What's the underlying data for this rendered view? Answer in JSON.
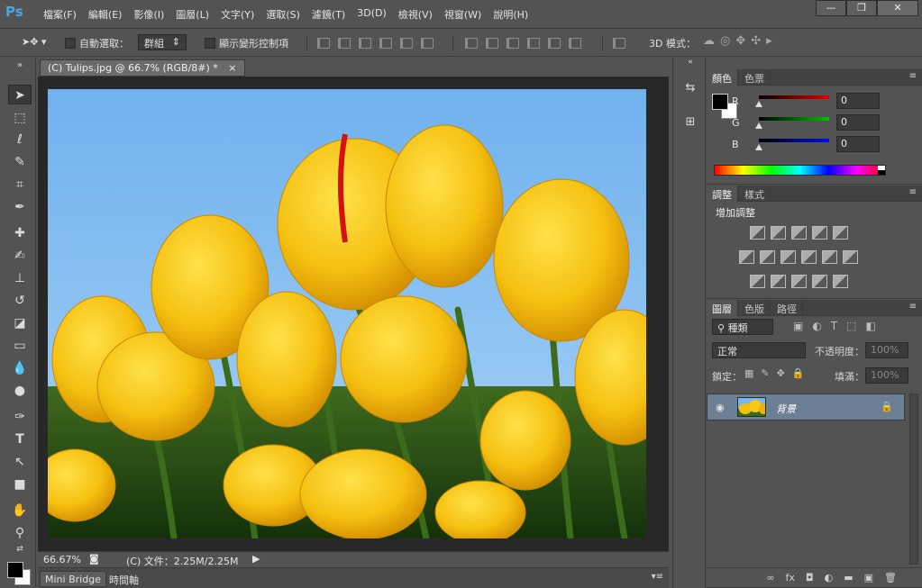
{
  "app": {
    "logo": "Ps",
    "menus": [
      "檔案(F)",
      "編輯(E)",
      "影像(I)",
      "圖層(L)",
      "文字(Y)",
      "選取(S)",
      "濾鏡(T)",
      "3D(D)",
      "檢視(V)",
      "視窗(W)",
      "說明(H)"
    ],
    "window_controls": [
      "—",
      "❐",
      "✕"
    ]
  },
  "options_bar": {
    "auto_select_label": "自動選取：",
    "auto_select_mode": "群組",
    "transform_controls_label": "顯示變形控制項",
    "mode_3d_label": "3D 模式："
  },
  "document": {
    "tab_title": "(C) Tulips.jpg @ 66.7% (RGB/8#) *",
    "tab_close": "×",
    "zoom": "66.67%",
    "file_info": "(C) 文件：2.25M/2.25M"
  },
  "bottom_tabs": [
    "Mini Bridge",
    "時間軸"
  ],
  "color_panel": {
    "tabs": [
      "顏色",
      "色票"
    ],
    "channels": [
      {
        "label": "R",
        "value": "0",
        "color": "#e00000"
      },
      {
        "label": "G",
        "value": "0",
        "color": "#00c000"
      },
      {
        "label": "B",
        "value": "0",
        "color": "#0010e0"
      }
    ]
  },
  "adjustments_panel": {
    "tabs": [
      "調整",
      "樣式"
    ],
    "heading": "增加調整"
  },
  "layers_panel": {
    "tabs": [
      "圖層",
      "色版",
      "路徑"
    ],
    "filter_kind": "種類",
    "blend_mode": "正常",
    "opacity_label": "不透明度：",
    "opacity_value": "100%",
    "lock_label": "鎖定：",
    "fill_label": "填滿：",
    "fill_value": "100%",
    "layer_name": "背景",
    "footer_icons": [
      "∞",
      "fx",
      "◘",
      "◐",
      "▬",
      "▣",
      "🗑"
    ]
  },
  "colors": {
    "foreground": "#000000",
    "background": "#ffffff",
    "ui_bg": "#535353",
    "selected_layer": "#6d7f95"
  }
}
